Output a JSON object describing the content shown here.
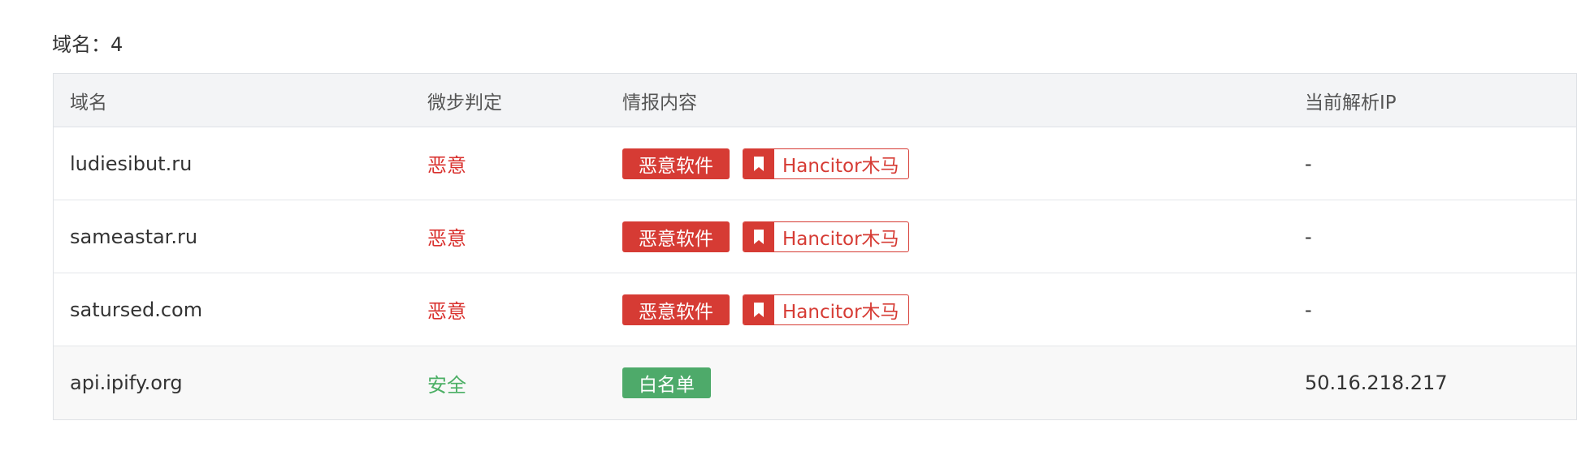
{
  "section": {
    "title": "域名：4"
  },
  "table": {
    "headers": {
      "domain": "域名",
      "verdict": "微步判定",
      "intel": "情报内容",
      "ip": "当前解析IP"
    },
    "rows": [
      {
        "domain": "ludiesibut.ru",
        "verdict": "恶意",
        "tag_primary": "恶意软件",
        "tag_secondary": "Hancitor木马",
        "ip": "-"
      },
      {
        "domain": "sameastar.ru",
        "verdict": "恶意",
        "tag_primary": "恶意软件",
        "tag_secondary": "Hancitor木马",
        "ip": "-"
      },
      {
        "domain": "satursed.com",
        "verdict": "恶意",
        "tag_primary": "恶意软件",
        "tag_secondary": "Hancitor木马",
        "ip": "-"
      },
      {
        "domain": "api.ipify.org",
        "verdict": "安全",
        "tag_primary": "白名单",
        "ip": "50.16.218.217"
      }
    ]
  },
  "icons": {
    "tag_secondary_icon": "bookmark-icon"
  },
  "colors": {
    "malicious": "#d63b34",
    "safe": "#4eaa6a",
    "header_bg": "#f3f4f6"
  }
}
